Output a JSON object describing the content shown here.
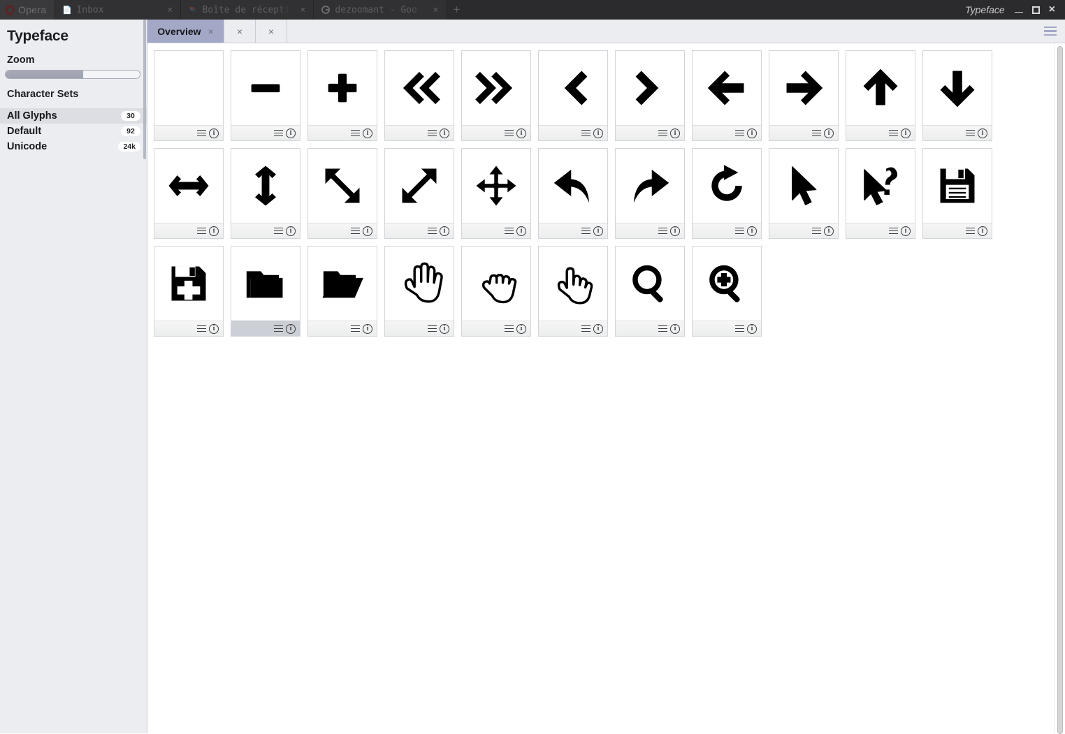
{
  "browser": {
    "brand": {
      "label": "Opera",
      "icon": "opera-logo"
    },
    "tabs": [
      {
        "label": "Inbox",
        "icon": "document-favicon",
        "close": "×"
      },
      {
        "label": "Boîte de récepti",
        "icon": "thunderbird-favicon",
        "close": "×"
      },
      {
        "label": "dezoomant - Goo",
        "icon": "google-favicon",
        "close": "×"
      }
    ],
    "new_tab_label": "+"
  },
  "window": {
    "title": "Typeface",
    "controls": {
      "minimize": "–",
      "maximize": "□",
      "close": "×"
    }
  },
  "sidebar": {
    "app_title": "Typeface",
    "zoom_label": "Zoom",
    "zoom_value_percent": 58,
    "charsets_label": "Character Sets",
    "charsets": [
      {
        "label": "All Glyphs",
        "count": "30",
        "selected": true
      },
      {
        "label": "Default",
        "count": "92",
        "selected": false
      },
      {
        "label": "Unicode",
        "count": "24k",
        "selected": false
      }
    ]
  },
  "tabstrip": {
    "tabs": [
      {
        "label": "Overview",
        "close": "×",
        "active": true
      },
      {
        "label": "",
        "close": "×",
        "active": false
      },
      {
        "label": "",
        "close": "×",
        "active": false
      }
    ],
    "menu_icon": "hamburger-menu-icon"
  },
  "glyph_footer": {
    "menu_icon": "glyph-menu-icon",
    "info_icon": "glyph-info-icon",
    "info_char": "i"
  },
  "glyphs": [
    {
      "name": "blank-glyph",
      "icon": "blank",
      "hovered": false
    },
    {
      "name": "minus-glyph",
      "icon": "minus",
      "hovered": false
    },
    {
      "name": "plus-glyph",
      "icon": "plus",
      "hovered": false
    },
    {
      "name": "double-chevron-left-glyph",
      "icon": "dchev-left",
      "hovered": false
    },
    {
      "name": "double-chevron-right-glyph",
      "icon": "dchev-right",
      "hovered": false
    },
    {
      "name": "chevron-left-glyph",
      "icon": "chev-left",
      "hovered": false
    },
    {
      "name": "chevron-right-glyph",
      "icon": "chev-right",
      "hovered": false
    },
    {
      "name": "arrow-left-glyph",
      "icon": "arrow-left",
      "hovered": false
    },
    {
      "name": "arrow-right-glyph",
      "icon": "arrow-right",
      "hovered": false
    },
    {
      "name": "arrow-up-glyph",
      "icon": "arrow-up",
      "hovered": false
    },
    {
      "name": "arrow-down-glyph",
      "icon": "arrow-down",
      "hovered": false
    },
    {
      "name": "resize-horizontal-glyph",
      "icon": "resize-h",
      "hovered": false
    },
    {
      "name": "resize-vertical-glyph",
      "icon": "resize-v",
      "hovered": false
    },
    {
      "name": "resize-nwse-glyph",
      "icon": "resize-nwse",
      "hovered": false
    },
    {
      "name": "resize-nesw-glyph",
      "icon": "resize-nesw",
      "hovered": false
    },
    {
      "name": "move-glyph",
      "icon": "move",
      "hovered": false
    },
    {
      "name": "undo-glyph",
      "icon": "undo",
      "hovered": false
    },
    {
      "name": "redo-glyph",
      "icon": "redo",
      "hovered": false
    },
    {
      "name": "refresh-glyph",
      "icon": "refresh",
      "hovered": false
    },
    {
      "name": "cursor-arrow-glyph",
      "icon": "cursor",
      "hovered": false
    },
    {
      "name": "cursor-help-glyph",
      "icon": "cursor-help",
      "hovered": false
    },
    {
      "name": "save-glyph",
      "icon": "floppy",
      "hovered": false
    },
    {
      "name": "save-as-glyph",
      "icon": "floppy-plus",
      "hovered": false
    },
    {
      "name": "folder-closed-glyph",
      "icon": "folder",
      "hovered": true
    },
    {
      "name": "folder-open-glyph",
      "icon": "folder-open",
      "hovered": false
    },
    {
      "name": "hand-open-glyph",
      "icon": "hand-open",
      "hovered": false
    },
    {
      "name": "hand-grab-glyph",
      "icon": "hand-grab",
      "hovered": false
    },
    {
      "name": "hand-point-glyph",
      "icon": "hand-point",
      "hovered": false
    },
    {
      "name": "magnifier-glyph",
      "icon": "magnifier",
      "hovered": false
    },
    {
      "name": "magnifier-plus-glyph",
      "icon": "magnifier-plus",
      "hovered": false
    }
  ],
  "colors": {
    "sidebar_bg": "#ebedf1",
    "tab_active": "#a3a8c6",
    "accent": "#a3a8c6",
    "titlebar_bg": "#2b2b2d",
    "glyph_ink": "#000000"
  }
}
